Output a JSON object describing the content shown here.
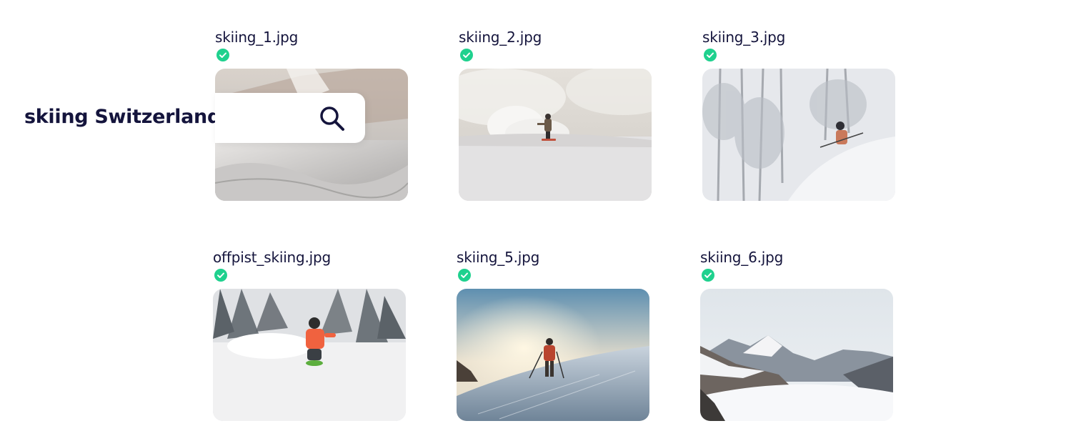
{
  "search": {
    "query": "skiing Switzerland",
    "icon": "search-icon"
  },
  "results": [
    {
      "filename": "skiing_1.jpg",
      "status_icon": "check-circle-icon",
      "status_color": "#1fd18e"
    },
    {
      "filename": "skiing_2.jpg",
      "status_icon": "check-circle-icon",
      "status_color": "#1fd18e"
    },
    {
      "filename": "skiing_3.jpg",
      "status_icon": "check-circle-icon",
      "status_color": "#1fd18e"
    },
    {
      "filename": "offpist_skiing.jpg",
      "status_icon": "check-circle-icon",
      "status_color": "#1fd18e"
    },
    {
      "filename": "skiing_5.jpg",
      "status_icon": "check-circle-icon",
      "status_color": "#1fd18e"
    },
    {
      "filename": "skiing_6.jpg",
      "status_icon": "check-circle-icon",
      "status_color": "#1fd18e"
    }
  ],
  "colors": {
    "text": "#14143c",
    "check": "#1fd18e"
  }
}
